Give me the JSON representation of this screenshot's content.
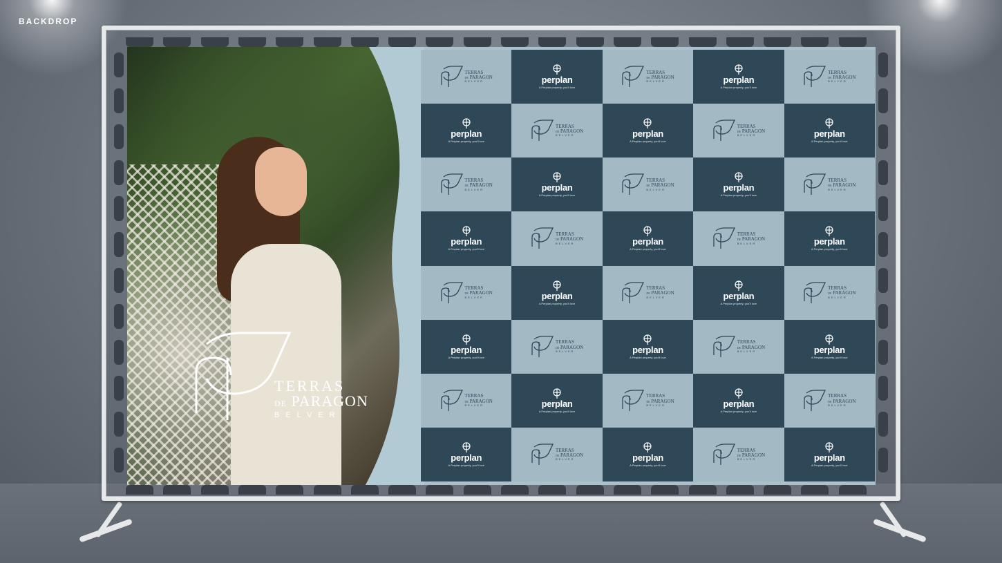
{
  "header": {
    "label": "BACKDROP"
  },
  "photo_logo": {
    "line1": "TERRAS",
    "line2_prefix": "DE",
    "line2": "PARAGON",
    "line3": "BELVER"
  },
  "grid": {
    "rows": 8,
    "cols": 5,
    "perplan": {
      "name": "perplan",
      "tagline": "A Perplan property, you'll love"
    },
    "terras": {
      "line1": "TERRAS",
      "line2_prefix": "DE",
      "line2": "PARAGON",
      "line3": "BELVER"
    }
  },
  "colors": {
    "dark_panel": "#2f4858",
    "light_panel": "#a3bac4",
    "frame": "#e6e8ea"
  },
  "icons": [
    "perplan-logo-icon",
    "terras-de-paragon-monogram-icon"
  ]
}
